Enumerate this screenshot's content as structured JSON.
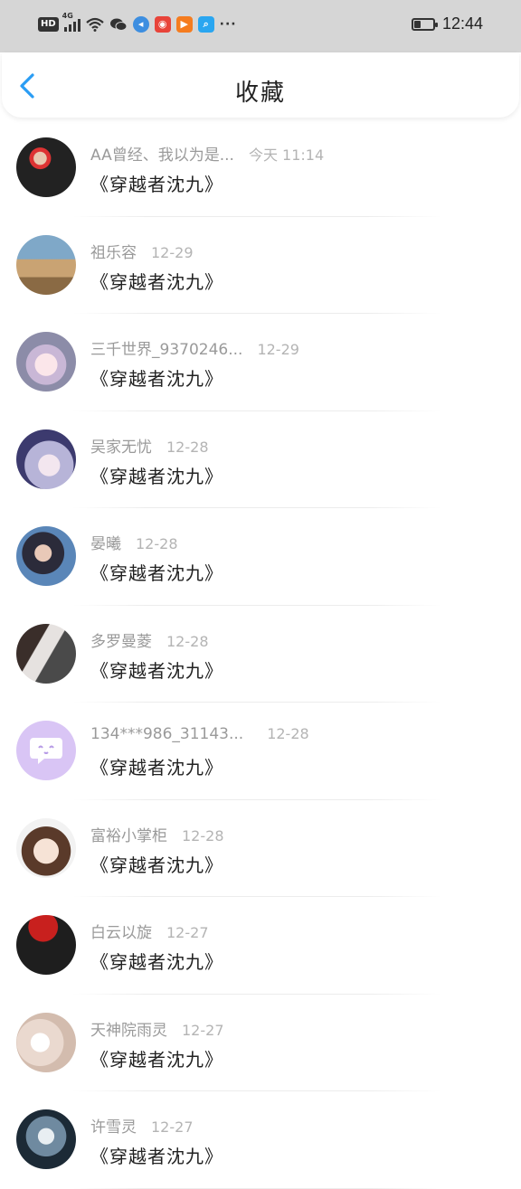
{
  "status_bar": {
    "hd": "HD",
    "network": "4G",
    "more": "···",
    "clock": "12:44",
    "battery_level": 0.3
  },
  "header": {
    "title": "收藏",
    "back_icon": "chevron-left-icon",
    "accent": "#2a9df4"
  },
  "items": [
    {
      "name": "AA曾经、我以为是...",
      "time": "今天 11:14",
      "work": "《穿越者沈九》"
    },
    {
      "name": "祖乐容",
      "time": "12-29",
      "work": "《穿越者沈九》"
    },
    {
      "name": "三千世界_9370246...",
      "time": "12-29",
      "work": "《穿越者沈九》"
    },
    {
      "name": "吴家无忧",
      "time": "12-28",
      "work": "《穿越者沈九》"
    },
    {
      "name": "晏曦",
      "time": "12-28",
      "work": "《穿越者沈九》"
    },
    {
      "name": "多罗曼菱",
      "time": "12-28",
      "work": "《穿越者沈九》"
    },
    {
      "name": "134***986_31143...",
      "time": "12-28",
      "work": "《穿越者沈九》"
    },
    {
      "name": "富裕小掌柜",
      "time": "12-28",
      "work": "《穿越者沈九》"
    },
    {
      "name": "白云以旋",
      "time": "12-27",
      "work": "《穿越者沈九》"
    },
    {
      "name": "天神院雨灵",
      "time": "12-27",
      "work": "《穿越者沈九》"
    },
    {
      "name": "许雪灵",
      "time": "12-27",
      "work": "《穿越者沈九》"
    }
  ]
}
